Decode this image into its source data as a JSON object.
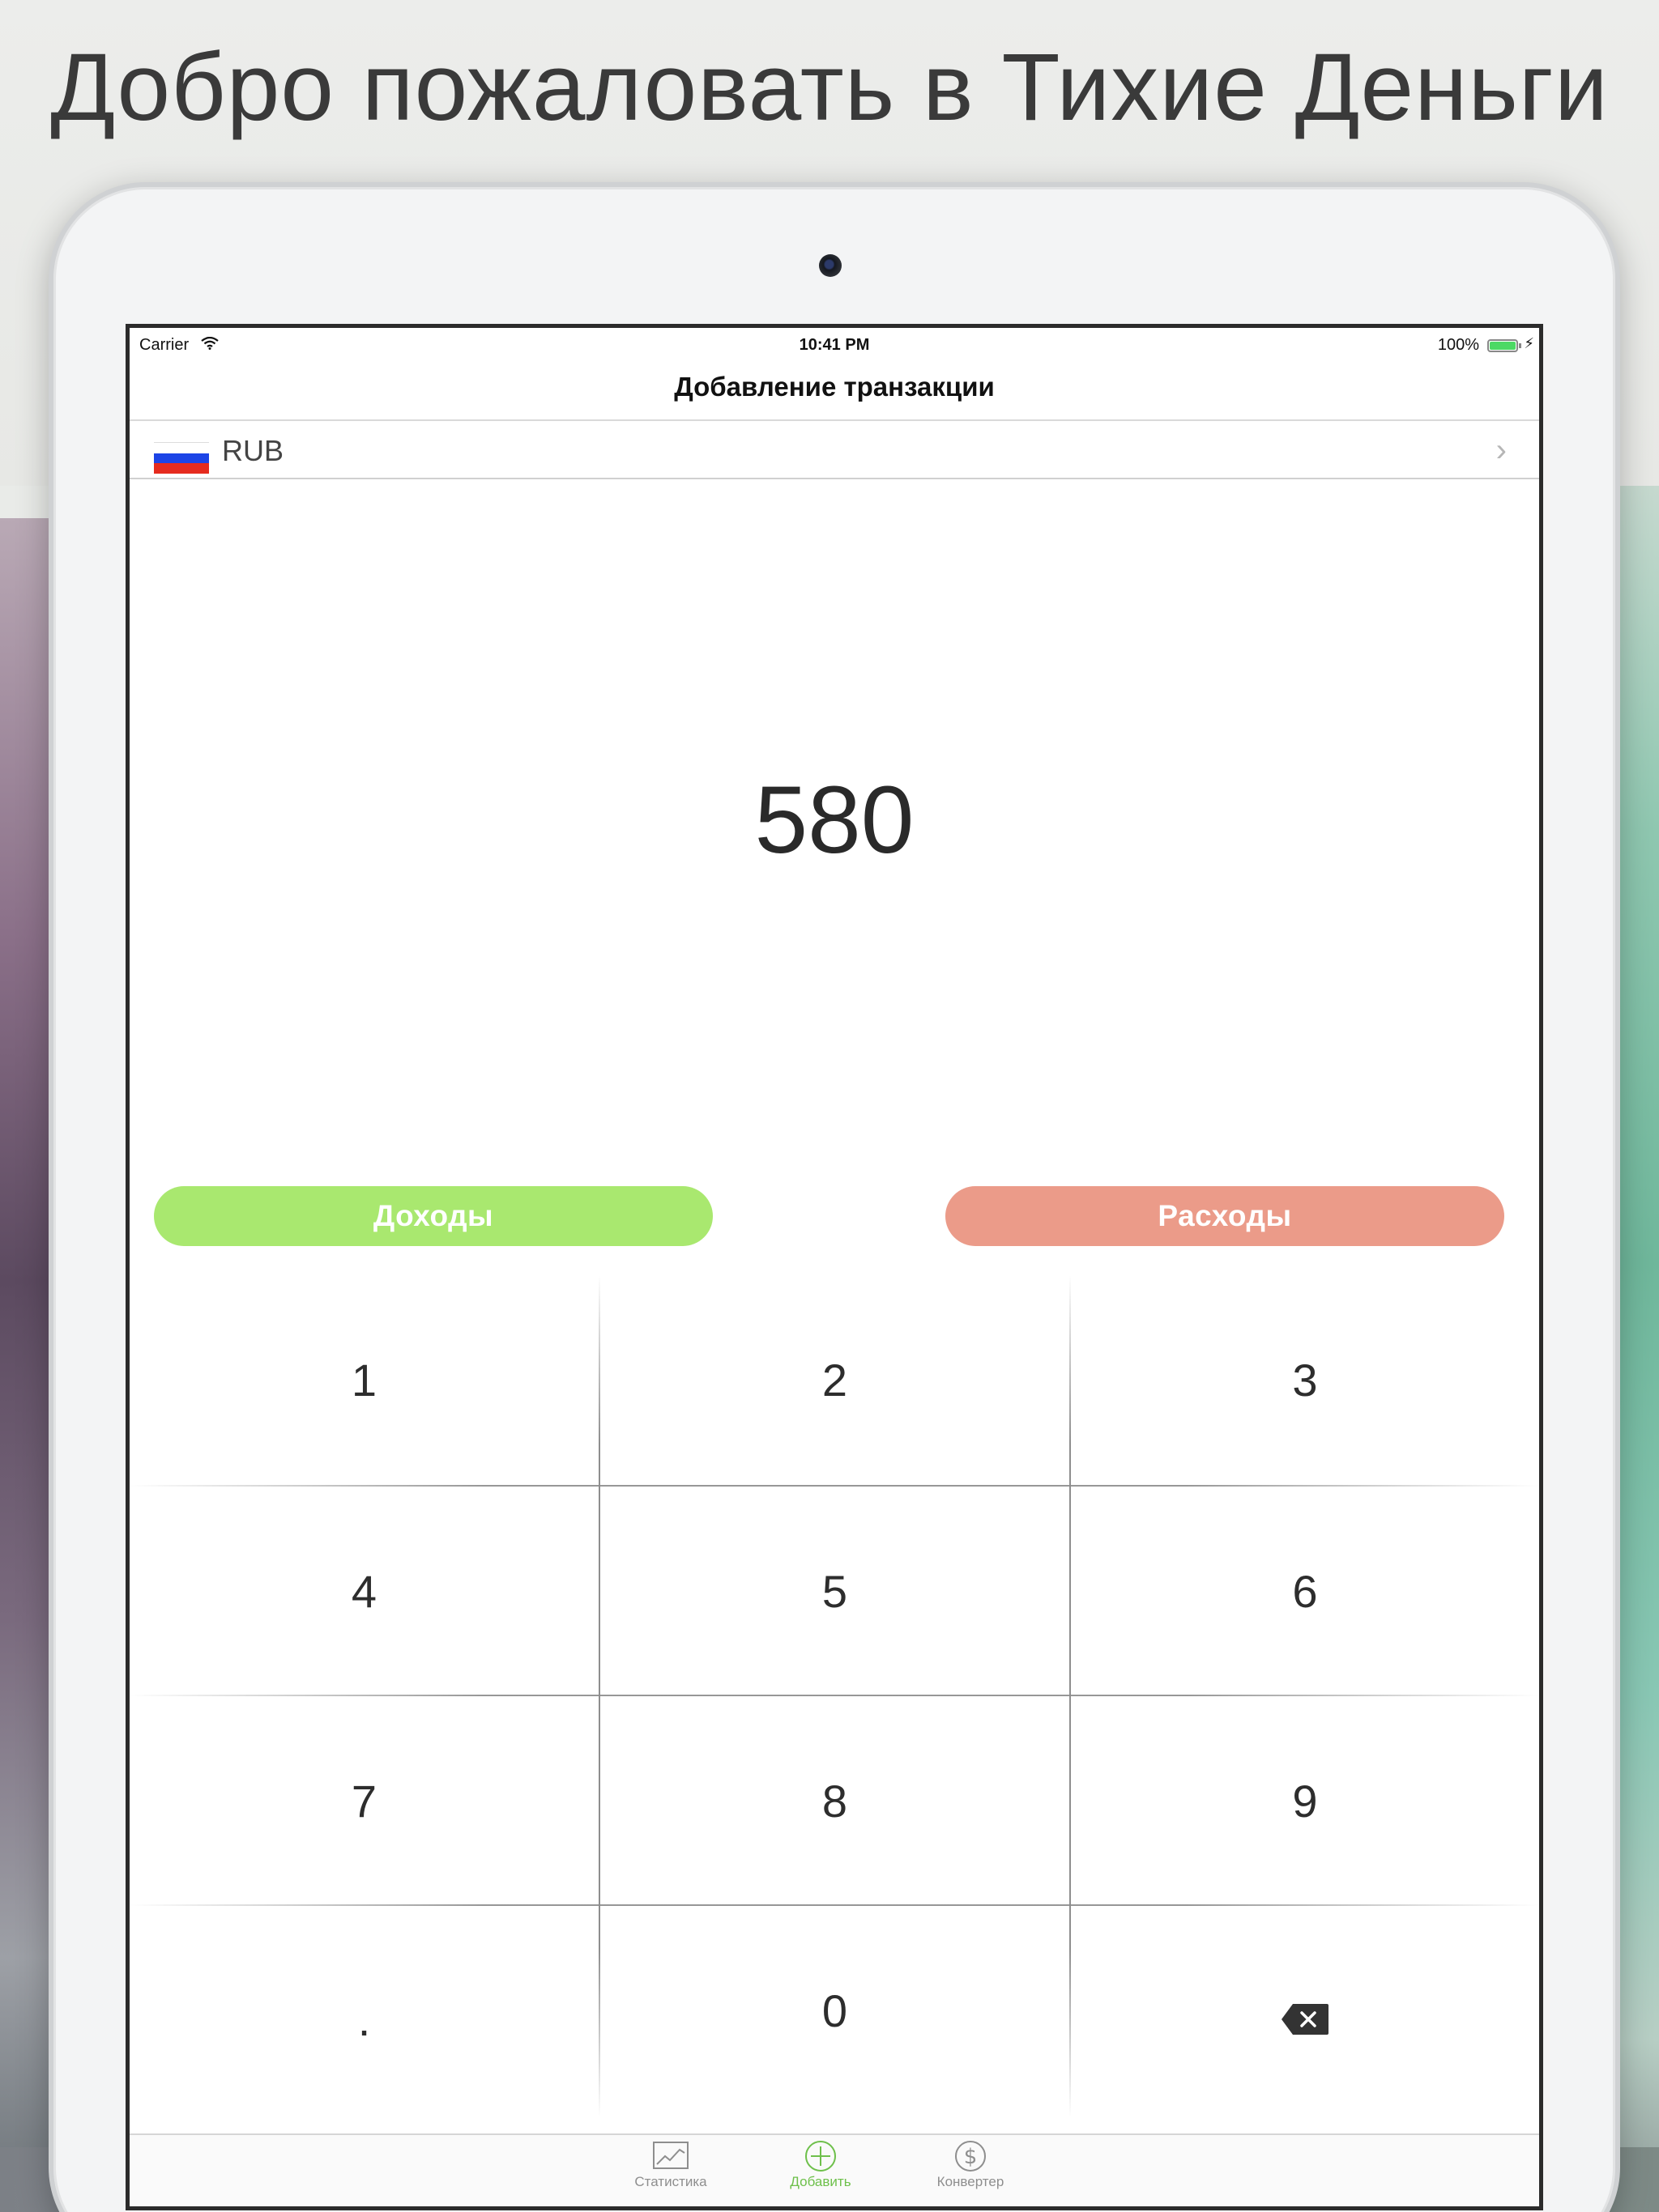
{
  "headline": "Добро пожаловать в Тихие Деньги",
  "status_bar": {
    "carrier": "Carrier",
    "time": "10:41 PM",
    "battery": "100%"
  },
  "nav": {
    "title": "Добавление транзакции"
  },
  "currency": {
    "code": "RUB",
    "flag": "russia-flag-icon"
  },
  "amount": "580",
  "type_buttons": {
    "income": "Доходы",
    "expense": "Расходы"
  },
  "keypad": {
    "keys": [
      "1",
      "2",
      "3",
      "4",
      "5",
      "6",
      "7",
      "8",
      "9",
      ".",
      "0"
    ],
    "backspace_icon": "backspace-icon"
  },
  "tabs": [
    {
      "label": "Статистика",
      "icon": "chart-icon",
      "active": false
    },
    {
      "label": "Добавить",
      "icon": "plus-circle-icon",
      "active": true
    },
    {
      "label": "Конвертер",
      "icon": "dollar-circle-icon",
      "active": false
    }
  ],
  "colors": {
    "income": "#a9e86f",
    "expense": "#eb9b89",
    "active_tab": "#6ec04b",
    "battery": "#4cd964"
  }
}
